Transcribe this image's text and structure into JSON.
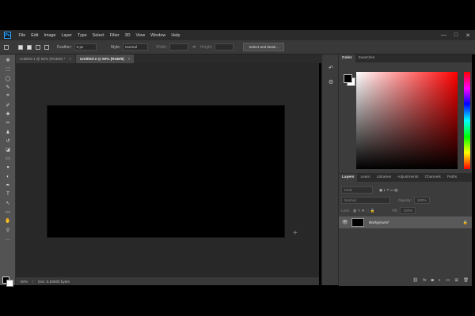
{
  "menu": {
    "logo": "Ps",
    "items": [
      "File",
      "Edit",
      "Image",
      "Layer",
      "Type",
      "Select",
      "Filter",
      "3D",
      "View",
      "Window",
      "Help"
    ],
    "window_controls": [
      "—",
      "□",
      "✕"
    ]
  },
  "options": {
    "feather_label": "Feather:",
    "feather_value": "0 px",
    "style_label": "Style:",
    "style_value": "Normal",
    "width_label": "Width:",
    "height_label": "Height:",
    "select_mask_label": "Select and Mask..."
  },
  "tabs": [
    {
      "label": "Untitled-1 @ 50% (RGB/8) *",
      "active": false,
      "close": "×"
    },
    {
      "label": "Untitled-2 @ 50% (RGB/8)",
      "active": true,
      "close": "×"
    }
  ],
  "tools": [
    "move-icon",
    "marquee-icon",
    "lasso-icon",
    "quick-select-icon",
    "crop-icon",
    "eyedropper-icon",
    "healing-icon",
    "brush-icon",
    "stamp-icon",
    "history-brush-icon",
    "eraser-icon",
    "gradient-icon",
    "blur-icon",
    "dodge-icon",
    "pen-icon",
    "type-icon",
    "path-select-icon",
    "shape-icon",
    "hand-icon",
    "zoom-icon",
    "more-icon"
  ],
  "tool_glyphs": [
    "✥",
    "⬚",
    "◯",
    "✎",
    "⌗",
    "✐",
    "✚",
    "✏",
    "♟",
    "↺",
    "◪",
    "▭",
    "●",
    "◐",
    "✒",
    "T",
    "↖",
    "▭",
    "✋",
    "⚲",
    "…"
  ],
  "status": {
    "zoom": "50%",
    "doc": "Doc: 5.93M/0 bytes"
  },
  "color_panel": {
    "tabs": [
      "Color",
      "Swatches"
    ],
    "foreground": "#000000",
    "background": "#ffffff"
  },
  "layers_panel": {
    "tabs": [
      "Layers",
      "Learn",
      "Libraries",
      "Adjustments",
      "Channels",
      "Paths"
    ],
    "filter_label": "Kind",
    "blend_mode": "Normal",
    "opacity_label": "Opacity:",
    "opacity_value": "100%",
    "lock_label": "Lock:",
    "fill_label": "Fill:",
    "fill_value": "100%",
    "layer_name": "Background"
  },
  "colors": {
    "accent": "#31a8ff",
    "canvas": "#000000",
    "workspace": "#282828"
  }
}
